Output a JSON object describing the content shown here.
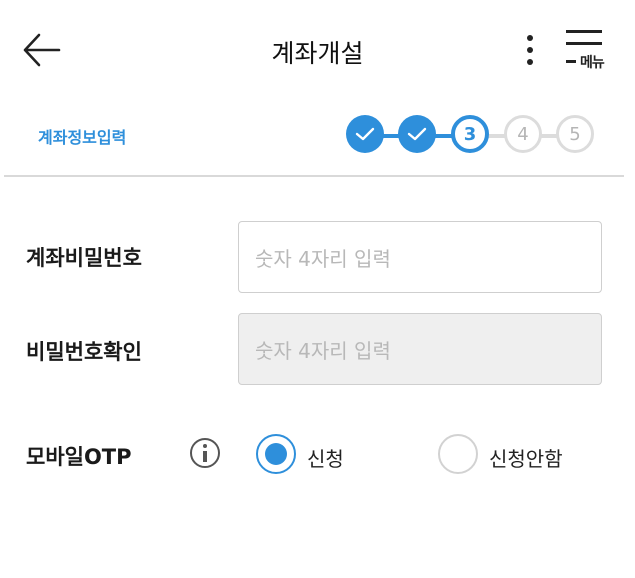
{
  "header": {
    "title": "계좌개설",
    "back_icon": "arrow-left-icon",
    "more_icon": "more-vertical-icon",
    "menu_label": "메뉴"
  },
  "progress": {
    "label": "계좌정보입력",
    "steps": [
      {
        "label": "",
        "state": "done"
      },
      {
        "label": "",
        "state": "done"
      },
      {
        "label": "3",
        "state": "current"
      },
      {
        "label": "4",
        "state": "todo"
      },
      {
        "label": "5",
        "state": "todo"
      }
    ]
  },
  "form": {
    "password": {
      "label": "계좌비밀번호",
      "placeholder": "숫자 4자리 입력",
      "value": ""
    },
    "password_confirm": {
      "label": "비밀번호확인",
      "placeholder": "숫자 4자리 입력",
      "value": ""
    },
    "otp": {
      "label": "모바일OTP",
      "info_icon": "info-icon",
      "options": [
        {
          "label": "신청",
          "selected": true
        },
        {
          "label": "신청안함",
          "selected": false
        }
      ]
    }
  },
  "colors": {
    "accent": "#2e8fdb",
    "inactive_step": "#dcdcdc",
    "disabled_field": "#efefef"
  }
}
